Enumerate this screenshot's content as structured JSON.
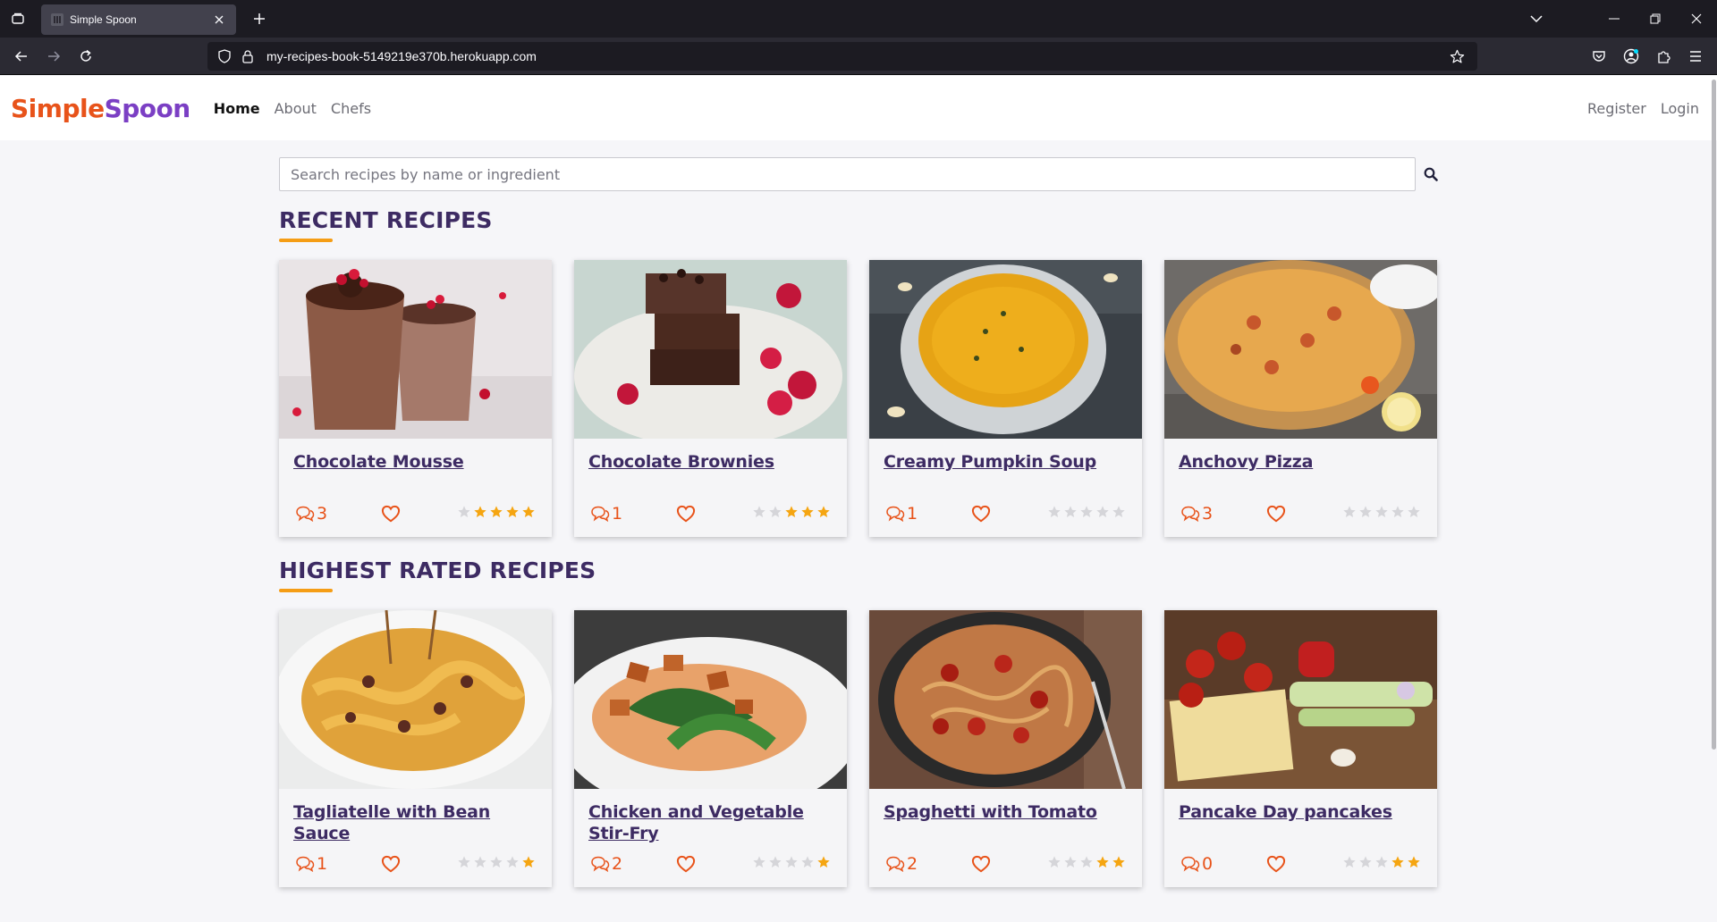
{
  "browser": {
    "tab_title": "Simple Spoon",
    "url": "my-recipes-book-5149219e370b.herokuapp.com"
  },
  "site": {
    "logo_part1": "Simple",
    "logo_part2": "Spoon",
    "nav": [
      "Home",
      "About",
      "Chefs"
    ],
    "auth": [
      "Register",
      "Login"
    ],
    "search_placeholder": "Search recipes by name or ingredient"
  },
  "colors": {
    "accent_orange": "#e8531a",
    "accent_purple": "#7b3fc4",
    "title_purple": "#3d2b63",
    "star_gold": "#f5a511",
    "star_empty": "#d5d5d9"
  },
  "sections": [
    {
      "title": "RECENT RECIPES",
      "recipes": [
        {
          "title": "Chocolate Mousse",
          "comments": "3",
          "rating": 4,
          "image": "chocolate-mousse"
        },
        {
          "title": "Chocolate Brownies",
          "comments": "1",
          "rating": 3,
          "image": "chocolate-brownies"
        },
        {
          "title": "Creamy Pumpkin Soup",
          "comments": "1",
          "rating": 0,
          "image": "pumpkin-soup"
        },
        {
          "title": "Anchovy Pizza",
          "comments": "3",
          "rating": 0,
          "image": "anchovy-pizza"
        }
      ]
    },
    {
      "title": "HIGHEST RATED RECIPES",
      "recipes": [
        {
          "title": "Tagliatelle with Bean Sauce",
          "comments": "1",
          "rating": 1,
          "image": "tagliatelle"
        },
        {
          "title": "Chicken and Vegetable Stir-Fry",
          "comments": "2",
          "rating": 1,
          "image": "chicken-stir-fry"
        },
        {
          "title": "Spaghetti with Tomato",
          "comments": "2",
          "rating": 2,
          "image": "spaghetti-tomato"
        },
        {
          "title": "Pancake Day pancakes",
          "comments": "0",
          "rating": 2,
          "image": "pancake-ingredients"
        }
      ]
    }
  ]
}
